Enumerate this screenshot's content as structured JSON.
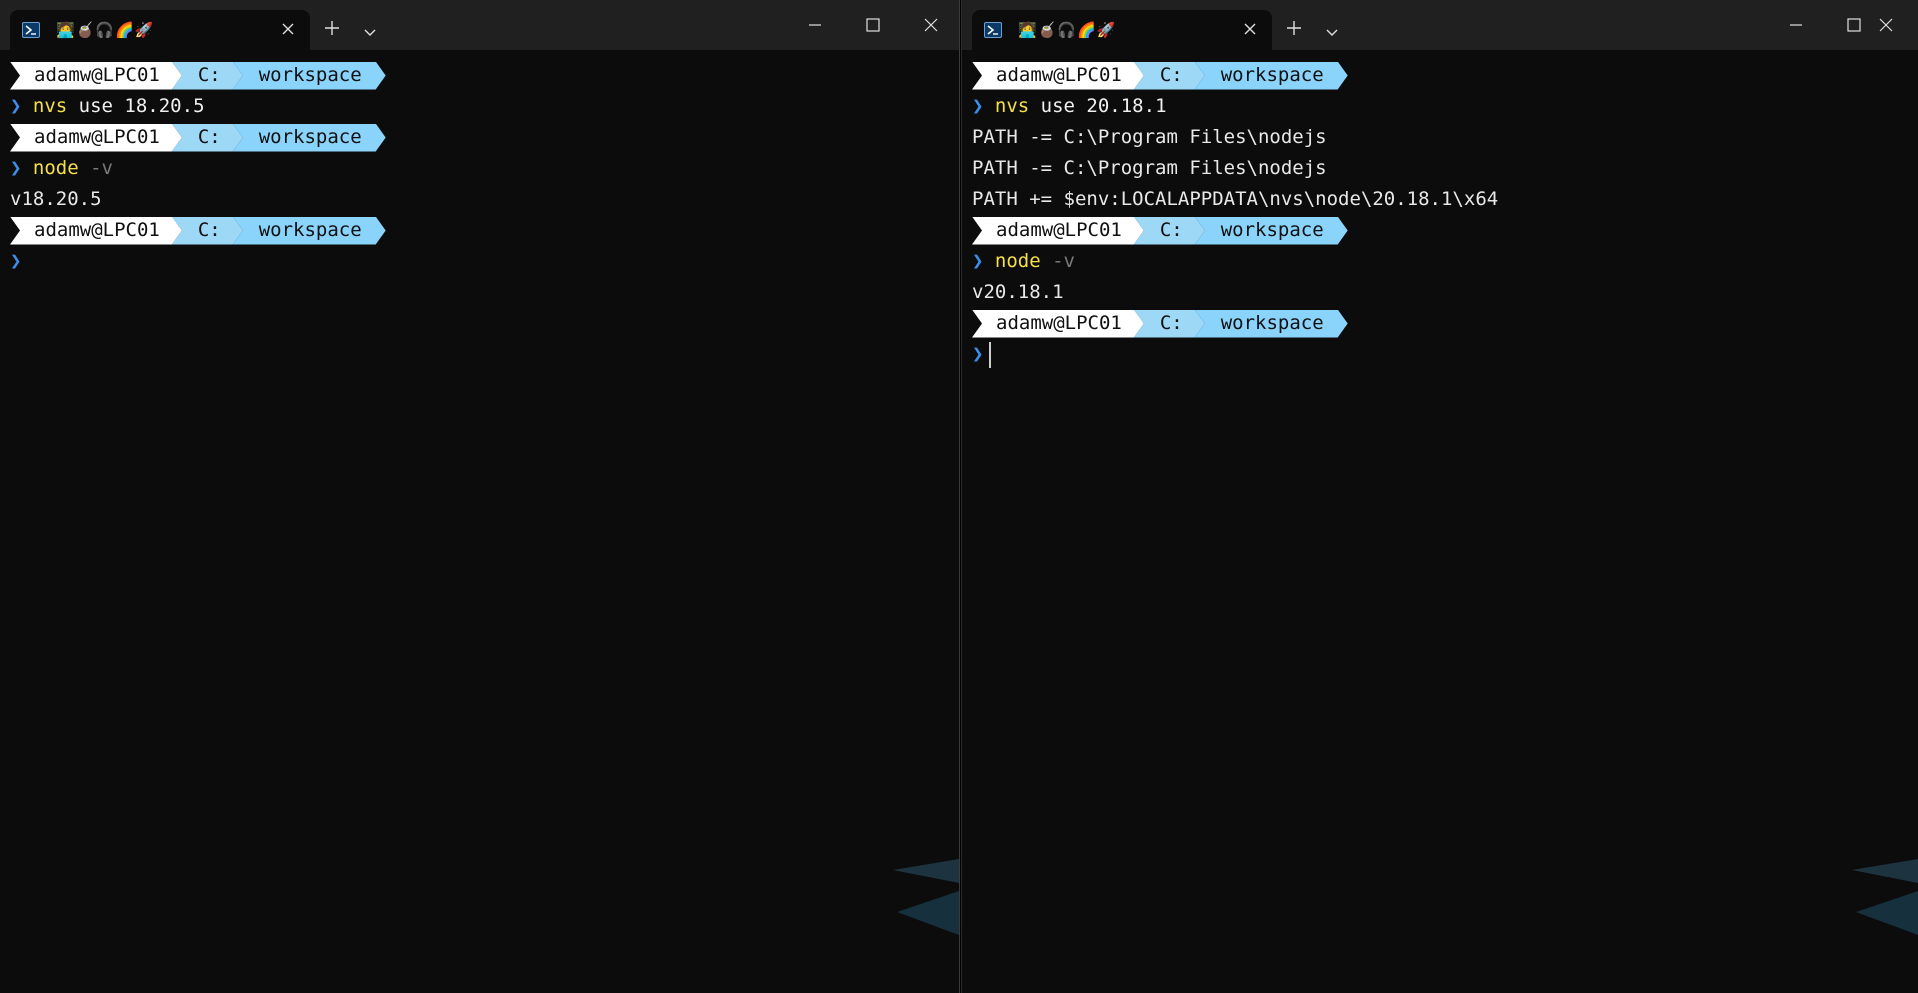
{
  "left": {
    "tab_title": "🧑‍💻🧉🎧🌈🚀",
    "lines": [
      {
        "type": "prompt",
        "user": "adamw@LPC01",
        "drive": "C:",
        "dir": "workspace"
      },
      {
        "type": "cmd",
        "chevron": "❯",
        "cmd": "nvs",
        "args": " use 18.20.5"
      },
      {
        "type": "prompt",
        "user": "adamw@LPC01",
        "drive": "C:",
        "dir": "workspace"
      },
      {
        "type": "cmd",
        "chevron": "❯",
        "cmd": "node",
        "flag": " -v"
      },
      {
        "type": "out",
        "text": "v18.20.5"
      },
      {
        "type": "prompt",
        "user": "adamw@LPC01",
        "drive": "C:",
        "dir": "workspace"
      },
      {
        "type": "cmd",
        "chevron": "❯"
      }
    ]
  },
  "right": {
    "tab_title": "🧑‍💻🧉🎧🌈🚀",
    "lines": [
      {
        "type": "prompt",
        "user": "adamw@LPC01",
        "drive": "C:",
        "dir": "workspace"
      },
      {
        "type": "cmd",
        "chevron": "❯",
        "cmd": "nvs",
        "args": " use 20.18.1"
      },
      {
        "type": "out",
        "text": "PATH -= C:\\Program Files\\nodejs"
      },
      {
        "type": "out",
        "text": "PATH -= C:\\Program Files\\nodejs"
      },
      {
        "type": "out",
        "text": "PATH += $env:LOCALAPPDATA\\nvs\\node\\20.18.1\\x64"
      },
      {
        "type": "prompt",
        "user": "adamw@LPC01",
        "drive": "C:",
        "dir": "workspace"
      },
      {
        "type": "cmd",
        "chevron": "❯",
        "cmd": "node",
        "flag": " -v"
      },
      {
        "type": "out",
        "text": "v20.18.1"
      },
      {
        "type": "prompt",
        "user": "adamw@LPC01",
        "drive": "C:",
        "dir": "workspace"
      },
      {
        "type": "cmd",
        "chevron": "❯",
        "cursor": true
      }
    ]
  },
  "icons": {
    "tab_icon": "powershell-icon",
    "tab_close": "close-icon",
    "new_tab": "plus-icon",
    "tab_dropdown": "chevron-down-icon",
    "minimize": "minimize-icon",
    "maximize": "maximize-icon",
    "close": "close-icon"
  },
  "colors": {
    "terminal_bg": "#0c0c0c",
    "titlebar_bg": "#202020",
    "prompt_user_bg": "#ffffff",
    "prompt_path_bg": "#8ad3fa",
    "chevron": "#3b8eea",
    "command": "#f5e04a"
  }
}
